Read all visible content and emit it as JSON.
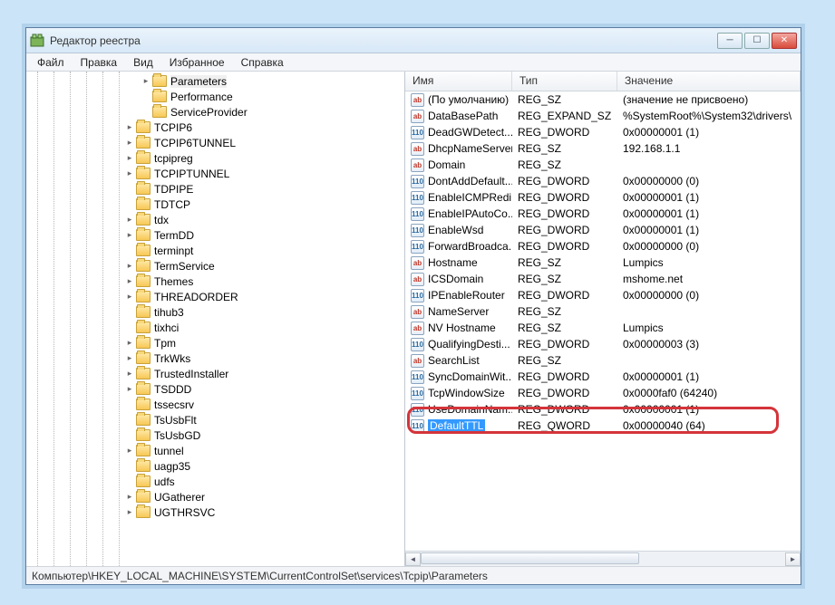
{
  "window": {
    "title": "Редактор реестра"
  },
  "menu": {
    "file": "Файл",
    "edit": "Правка",
    "view": "Вид",
    "favorites": "Избранное",
    "help": "Справка"
  },
  "columns": {
    "name": "Имя",
    "type": "Тип",
    "value": "Значение"
  },
  "tree": [
    {
      "indent": 7,
      "twisty": "▸",
      "label": "Parameters",
      "sel": true
    },
    {
      "indent": 7,
      "twisty": "",
      "label": "Performance"
    },
    {
      "indent": 7,
      "twisty": "",
      "label": "ServiceProvider"
    },
    {
      "indent": 6,
      "twisty": "▸",
      "label": "TCPIP6"
    },
    {
      "indent": 6,
      "twisty": "▸",
      "label": "TCPIP6TUNNEL"
    },
    {
      "indent": 6,
      "twisty": "▸",
      "label": "tcpipreg"
    },
    {
      "indent": 6,
      "twisty": "▸",
      "label": "TCPIPTUNNEL"
    },
    {
      "indent": 6,
      "twisty": "",
      "label": "TDPIPE"
    },
    {
      "indent": 6,
      "twisty": "",
      "label": "TDTCP"
    },
    {
      "indent": 6,
      "twisty": "▸",
      "label": "tdx"
    },
    {
      "indent": 6,
      "twisty": "▸",
      "label": "TermDD"
    },
    {
      "indent": 6,
      "twisty": "",
      "label": "terminpt"
    },
    {
      "indent": 6,
      "twisty": "▸",
      "label": "TermService"
    },
    {
      "indent": 6,
      "twisty": "▸",
      "label": "Themes"
    },
    {
      "indent": 6,
      "twisty": "▸",
      "label": "THREADORDER"
    },
    {
      "indent": 6,
      "twisty": "",
      "label": "tihub3"
    },
    {
      "indent": 6,
      "twisty": "",
      "label": "tixhci"
    },
    {
      "indent": 6,
      "twisty": "▸",
      "label": "Tpm"
    },
    {
      "indent": 6,
      "twisty": "▸",
      "label": "TrkWks"
    },
    {
      "indent": 6,
      "twisty": "▸",
      "label": "TrustedInstaller"
    },
    {
      "indent": 6,
      "twisty": "▸",
      "label": "TSDDD"
    },
    {
      "indent": 6,
      "twisty": "",
      "label": "tssecsrv"
    },
    {
      "indent": 6,
      "twisty": "",
      "label": "TsUsbFlt"
    },
    {
      "indent": 6,
      "twisty": "",
      "label": "TsUsbGD"
    },
    {
      "indent": 6,
      "twisty": "▸",
      "label": "tunnel"
    },
    {
      "indent": 6,
      "twisty": "",
      "label": "uagp35"
    },
    {
      "indent": 6,
      "twisty": "",
      "label": "udfs"
    },
    {
      "indent": 6,
      "twisty": "▸",
      "label": "UGatherer"
    },
    {
      "indent": 6,
      "twisty": "▸",
      "label": "UGTHRSVC"
    }
  ],
  "values": [
    {
      "icon": "str",
      "name": "(По умолчанию)",
      "type": "REG_SZ",
      "value": "(значение не присвоено)"
    },
    {
      "icon": "str",
      "name": "DataBasePath",
      "type": "REG_EXPAND_SZ",
      "value": "%SystemRoot%\\System32\\drivers\\"
    },
    {
      "icon": "bin",
      "name": "DeadGWDetect...",
      "type": "REG_DWORD",
      "value": "0x00000001 (1)"
    },
    {
      "icon": "str",
      "name": "DhcpNameServer",
      "type": "REG_SZ",
      "value": "192.168.1.1"
    },
    {
      "icon": "str",
      "name": "Domain",
      "type": "REG_SZ",
      "value": ""
    },
    {
      "icon": "bin",
      "name": "DontAddDefault...",
      "type": "REG_DWORD",
      "value": "0x00000000 (0)"
    },
    {
      "icon": "bin",
      "name": "EnableICMPRedi...",
      "type": "REG_DWORD",
      "value": "0x00000001 (1)"
    },
    {
      "icon": "bin",
      "name": "EnableIPAutoCo...",
      "type": "REG_DWORD",
      "value": "0x00000001 (1)"
    },
    {
      "icon": "bin",
      "name": "EnableWsd",
      "type": "REG_DWORD",
      "value": "0x00000001 (1)"
    },
    {
      "icon": "bin",
      "name": "ForwardBroadca...",
      "type": "REG_DWORD",
      "value": "0x00000000 (0)"
    },
    {
      "icon": "str",
      "name": "Hostname",
      "type": "REG_SZ",
      "value": "Lumpics"
    },
    {
      "icon": "str",
      "name": "ICSDomain",
      "type": "REG_SZ",
      "value": "mshome.net"
    },
    {
      "icon": "bin",
      "name": "IPEnableRouter",
      "type": "REG_DWORD",
      "value": "0x00000000 (0)"
    },
    {
      "icon": "str",
      "name": "NameServer",
      "type": "REG_SZ",
      "value": ""
    },
    {
      "icon": "str",
      "name": "NV Hostname",
      "type": "REG_SZ",
      "value": "Lumpics"
    },
    {
      "icon": "bin",
      "name": "QualifyingDesti...",
      "type": "REG_DWORD",
      "value": "0x00000003 (3)"
    },
    {
      "icon": "str",
      "name": "SearchList",
      "type": "REG_SZ",
      "value": ""
    },
    {
      "icon": "bin",
      "name": "SyncDomainWit...",
      "type": "REG_DWORD",
      "value": "0x00000001 (1)"
    },
    {
      "icon": "bin",
      "name": "TcpWindowSize",
      "type": "REG_DWORD",
      "value": "0x0000faf0 (64240)"
    },
    {
      "icon": "bin",
      "name": "UseDomainNam...",
      "type": "REG_DWORD",
      "value": "0x00000001 (1)"
    },
    {
      "icon": "bin",
      "name": "DefaultTTL",
      "type": "REG_QWORD",
      "value": "0x00000040 (64)",
      "selected": true
    }
  ],
  "statusbar": "Компьютер\\HKEY_LOCAL_MACHINE\\SYSTEM\\CurrentControlSet\\services\\Tcpip\\Parameters"
}
